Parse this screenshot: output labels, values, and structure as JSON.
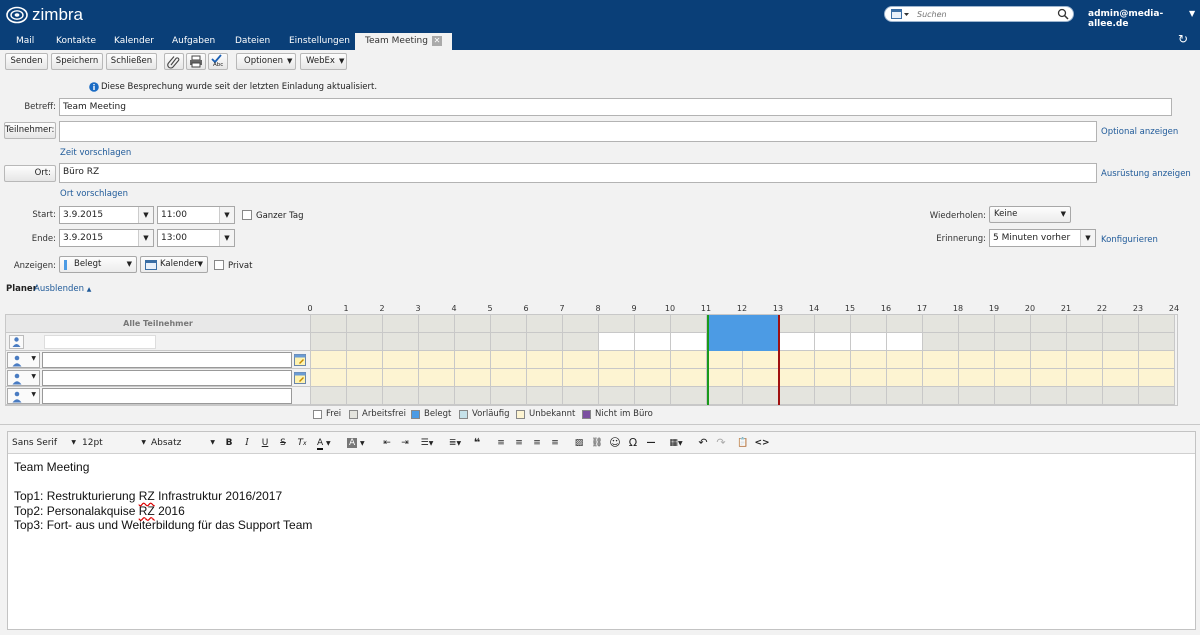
{
  "header": {
    "logo_text": "zimbra",
    "search_placeholder": "Suchen",
    "user": "admin@media-allee.de"
  },
  "tabs": [
    {
      "label": "Mail"
    },
    {
      "label": "Kontakte"
    },
    {
      "label": "Kalender"
    },
    {
      "label": "Aufgaben"
    },
    {
      "label": "Dateien"
    },
    {
      "label": "Einstellungen"
    },
    {
      "label": "Team Meeting"
    }
  ],
  "toolbar": {
    "send": "Senden",
    "save": "Speichern",
    "close": "Schließen",
    "spell_label": "Abc",
    "options": "Optionen",
    "webex": "WebEx"
  },
  "info_message": "Diese Besprechung wurde seit der letzten Einladung aktualisiert.",
  "form": {
    "subject_label": "Betreff:",
    "subject_value": "Team Meeting",
    "attendees_button": "Teilnehmer:",
    "attendees_value": "",
    "optional_link": "Optional anzeigen",
    "suggest_time": "Zeit vorschlagen",
    "location_button": "Ort:",
    "location_value": "Büro RZ",
    "equipment_link": "Ausrüstung anzeigen",
    "suggest_location": "Ort vorschlagen",
    "start_label": "Start:",
    "start_date": "3.9.2015",
    "start_time": "11:00",
    "allday_label": "Ganzer Tag",
    "end_label": "Ende:",
    "end_date": "3.9.2015",
    "end_time": "13:00",
    "repeat_label": "Wiederholen:",
    "repeat_value": "Keine",
    "reminder_label": "Erinnerung:",
    "reminder_value": "5 Minuten vorher",
    "configure_link": "Konfigurieren",
    "show_label": "Anzeigen:",
    "show_value": "Belegt",
    "calendar_value": "Kalender",
    "private_label": "Privat"
  },
  "planner": {
    "title": "Planer",
    "hide_link": "Ausblenden",
    "all_attendees": "Alle Teilnehmer",
    "hours": [
      "0",
      "1",
      "2",
      "3",
      "4",
      "5",
      "6",
      "7",
      "8",
      "9",
      "10",
      "11",
      "12",
      "13",
      "14",
      "15",
      "16",
      "17",
      "18",
      "19",
      "20",
      "21",
      "22",
      "23",
      "24"
    ],
    "legend": [
      "Frei",
      "Arbeitsfrei",
      "Belegt",
      "Vorläufig",
      "Unbekannt",
      "Nicht im Büro"
    ]
  },
  "editor": {
    "font": "Sans Serif",
    "size": "12pt",
    "format": "Absatz",
    "lines": [
      "Team Meeting",
      "",
      "Top1: Restrukturierung RZ Infrastruktur 2016/2017",
      "Top2: Personalakquise RZ 2016",
      "Top3: Fort- aus und Weiterbildung für das Support Team"
    ]
  },
  "colors": {
    "header_bg": "#0a3f78",
    "busy": "#4c9be4",
    "unknown": "#fdf4d2",
    "nonwork": "#e4e4de",
    "link": "#1f5a99"
  }
}
